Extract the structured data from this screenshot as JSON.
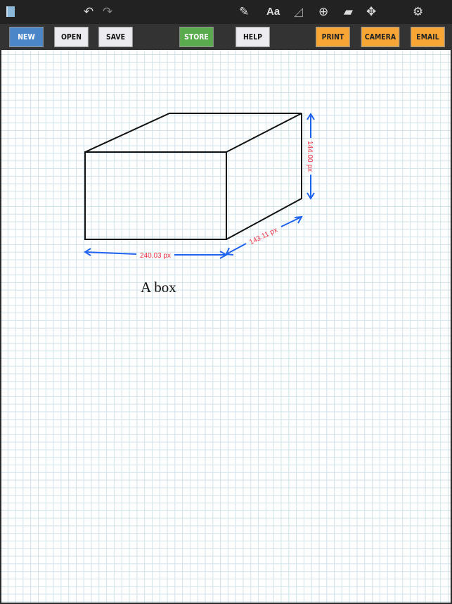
{
  "toolbar": {
    "icons": [
      "notebook-icon",
      "undo-icon",
      "redo-icon",
      "pencil-icon",
      "text-icon",
      "ruler-triangle-icon",
      "zoom-in-icon",
      "eraser-icon",
      "move-icon",
      "settings-gear-icon"
    ],
    "text_icon_label": "Aa"
  },
  "buttons": {
    "new": "NEW",
    "open": "OPEN",
    "save": "SAVE",
    "store": "STORE",
    "help": "HELP",
    "print": "PRINT",
    "camera": "CAMERA",
    "email": "EMAIL"
  },
  "colors": {
    "new": "#4a86c8",
    "store": "#5aaa4e",
    "orange": "#f7a535",
    "light": "#ececf0",
    "measure_line": "#1f62f0",
    "measure_text": "#f03040"
  },
  "drawing": {
    "width_label": "240.03 px",
    "depth_label": "143.11 px",
    "height_label": "144.00 px",
    "caption": "A box"
  }
}
